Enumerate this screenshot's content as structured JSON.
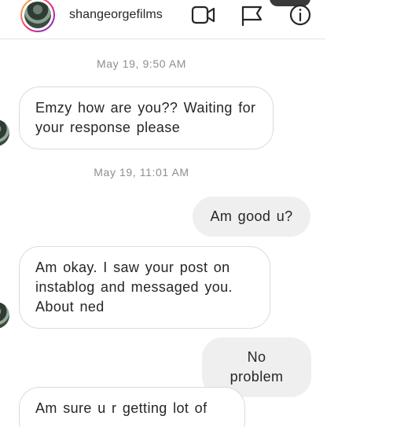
{
  "header": {
    "username": "shangeorgefilms",
    "icons": {
      "video": "video-camera-icon",
      "flag": "flag-icon",
      "info": "info-icon"
    }
  },
  "messages": [
    {
      "type": "timestamp",
      "text": "May 19, 9:50 AM"
    },
    {
      "type": "incoming",
      "text": "Emzy how are you??  Waiting for your response please"
    },
    {
      "type": "timestamp",
      "text": "May 19, 11:01 AM"
    },
    {
      "type": "outgoing",
      "text": "Am good u?"
    },
    {
      "type": "incoming",
      "text": "Am okay. I saw your post on instablog and messaged you. About ned"
    },
    {
      "type": "outgoing",
      "text": "No problem"
    },
    {
      "type": "incoming",
      "text": "Am sure u r getting lot of"
    }
  ],
  "colors": {
    "incoming_border": "#dbdbdb",
    "outgoing_bg": "#efefef",
    "timestamp": "#8e8e8e",
    "text": "#262626"
  }
}
